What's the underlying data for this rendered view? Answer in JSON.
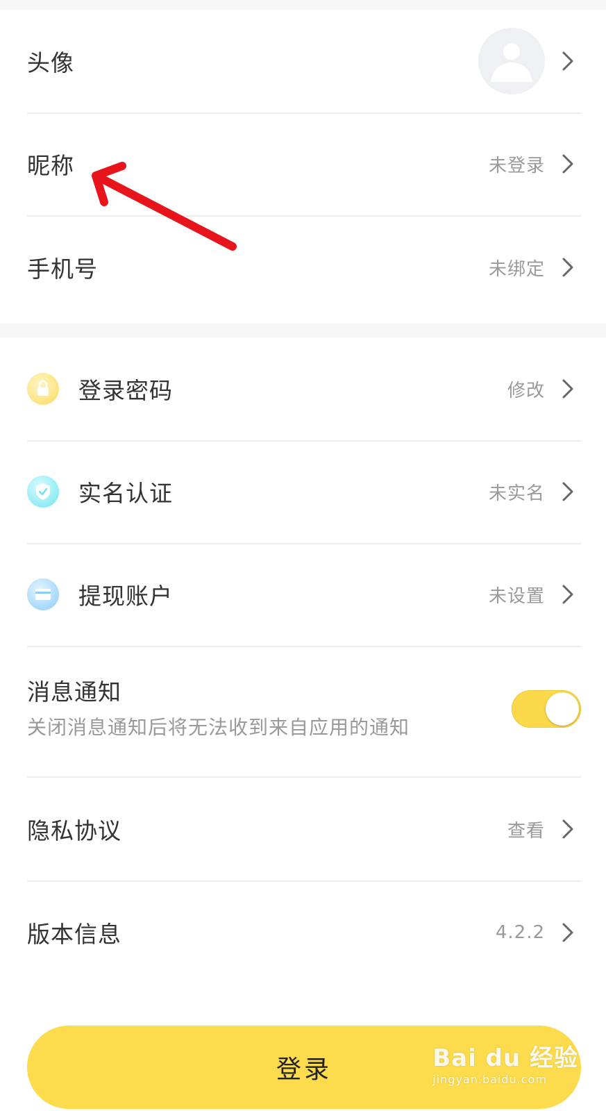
{
  "profile": {
    "avatar_label": "头像",
    "nickname_label": "昵称",
    "nickname_value": "未登录",
    "phone_label": "手机号",
    "phone_value": "未绑定"
  },
  "account": {
    "password_label": "登录密码",
    "password_value": "修改",
    "realname_label": "实名认证",
    "realname_value": "未实名",
    "withdraw_label": "提现账户",
    "withdraw_value": "未设置"
  },
  "notification": {
    "title": "消息通知",
    "subtitle": "关闭消息通知后将无法收到来自应用的通知",
    "enabled": true
  },
  "privacy": {
    "label": "隐私协议",
    "value": "查看"
  },
  "version": {
    "label": "版本信息",
    "value": "4.2.2"
  },
  "login_button": "登录",
  "watermark": {
    "brand": "Bai du 经验",
    "url": "jingyan.baidu.com"
  },
  "colors": {
    "accent": "#fcdb4c",
    "background": "#f5f5f5",
    "text": "#333333",
    "muted": "#999999",
    "arrow": "#e8141c"
  },
  "icons": {
    "lock": "lock-icon",
    "shield": "shield-check-icon",
    "card": "card-icon",
    "chevron": "chevron-right-icon",
    "avatar": "user-avatar-icon"
  }
}
